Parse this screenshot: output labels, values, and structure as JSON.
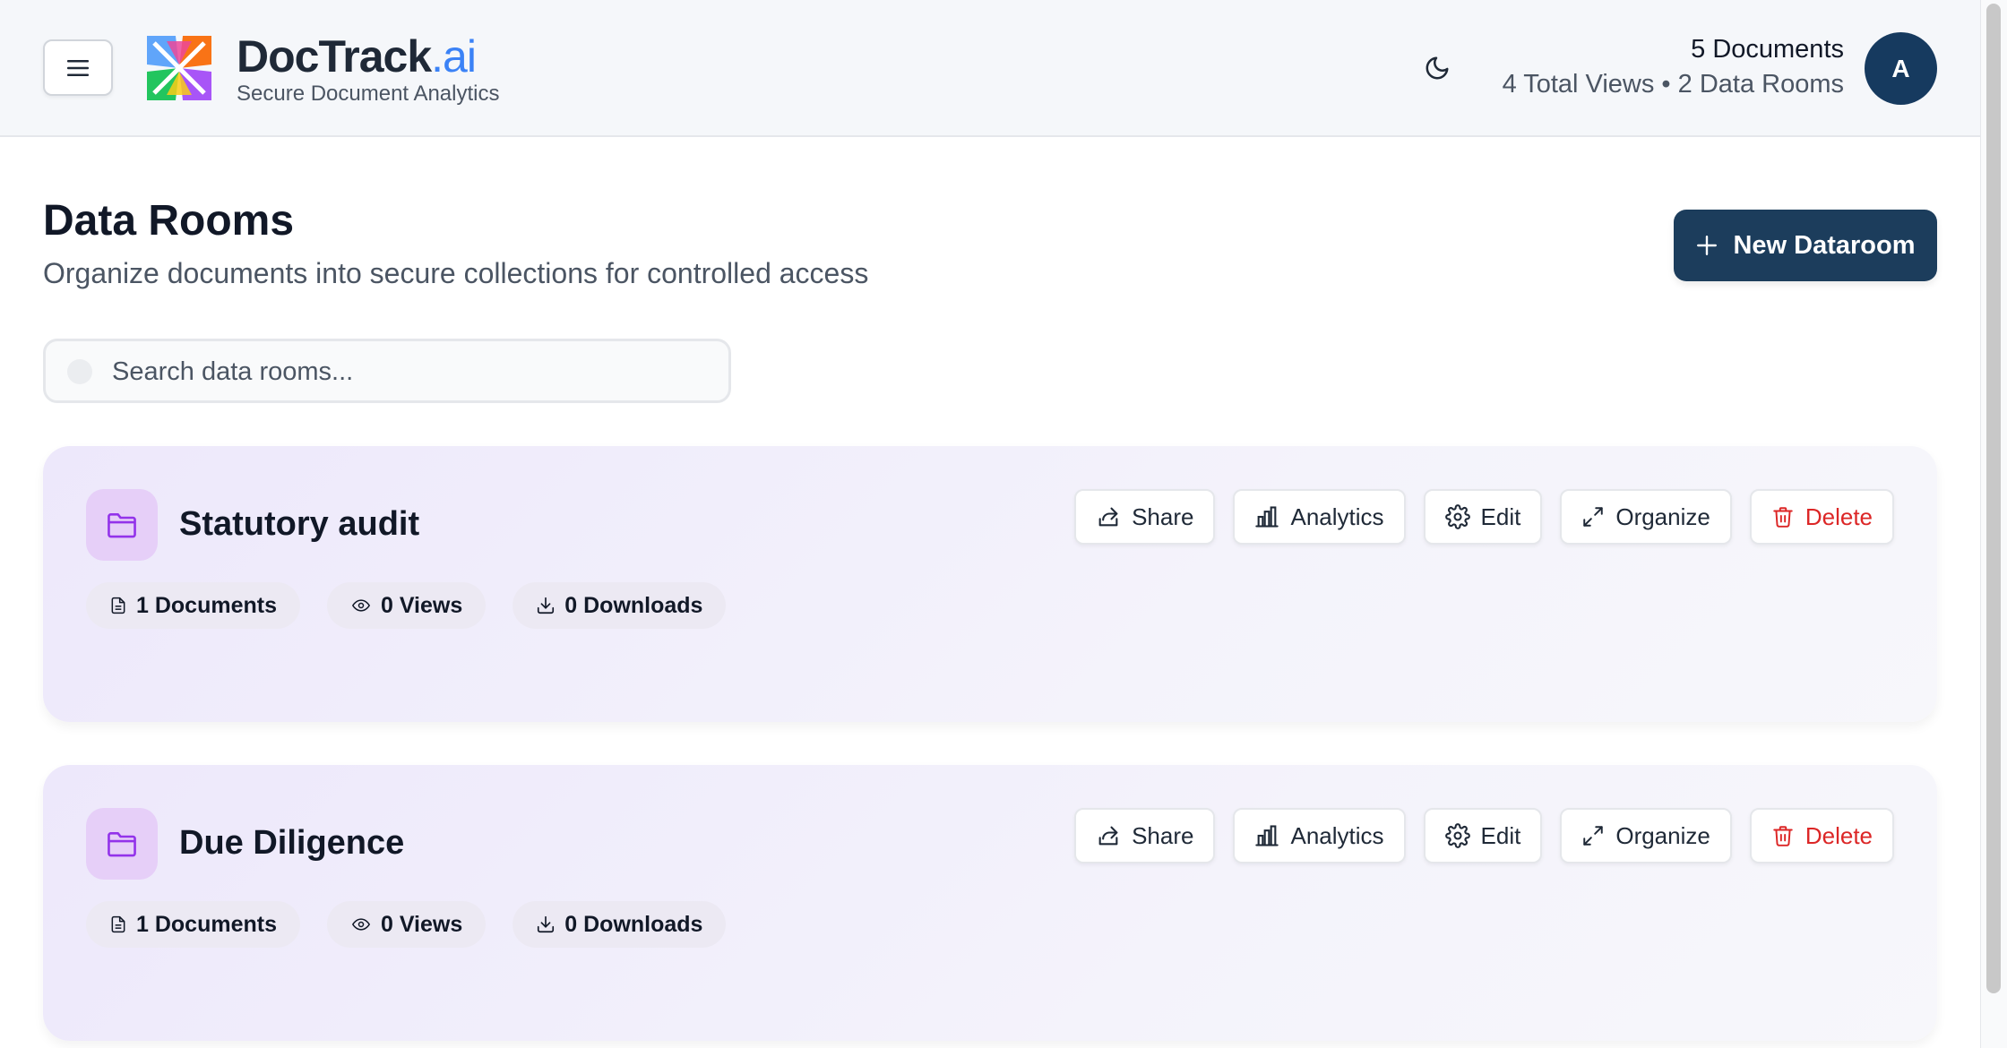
{
  "header": {
    "brand_name": "DocTrack",
    "brand_suffix": ".ai",
    "tagline": "Secure Document Analytics",
    "stats_main": "5 Documents",
    "stats_sub": "4 Total Views • 2 Data Rooms",
    "avatar_initial": "A"
  },
  "page": {
    "title": "Data Rooms",
    "subtitle": "Organize documents into secure collections for controlled access",
    "new_button_label": "New Dataroom"
  },
  "search": {
    "placeholder": "Search data rooms..."
  },
  "actions": {
    "share": "Share",
    "analytics": "Analytics",
    "edit": "Edit",
    "organize": "Organize",
    "delete": "Delete"
  },
  "datarooms": [
    {
      "name": "Statutory audit",
      "documents": "1 Documents",
      "views": "0 Views",
      "downloads": "0 Downloads"
    },
    {
      "name": "Due Diligence",
      "documents": "1 Documents",
      "views": "0 Views",
      "downloads": "0 Downloads"
    }
  ],
  "colors": {
    "primary": "#1c3d5c",
    "accent_blue": "#3b82f6",
    "danger": "#dc2626",
    "folder_purple": "#9333ea"
  },
  "icons": {
    "menu": "menu-icon",
    "logo": "doctrack-logo",
    "theme": "moon-icon",
    "folder": "folder-icon",
    "share": "share-icon",
    "analytics": "bar-chart-icon",
    "edit": "gear-icon",
    "organize": "expand-icon",
    "delete": "trash-icon",
    "documents": "file-icon",
    "views": "eye-icon",
    "downloads": "download-icon"
  }
}
